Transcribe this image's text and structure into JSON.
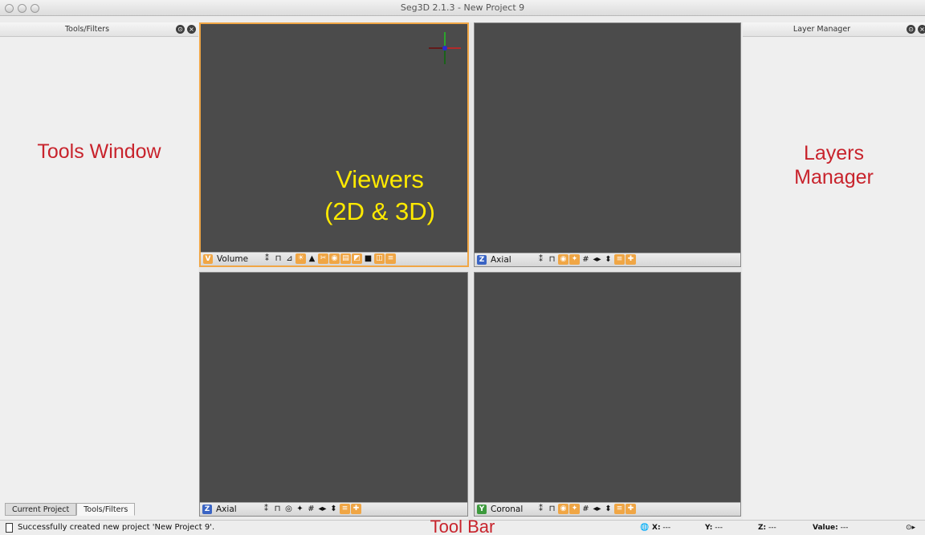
{
  "window": {
    "title": "Seg3D  2.1.3 - New Project 9"
  },
  "tools_panel": {
    "title": "Tools/Filters",
    "annotation": "Tools Window",
    "tabs": [
      "Current Project",
      "Tools/Filters"
    ],
    "active_tab": 1
  },
  "layer_panel": {
    "title": "Layer Manager",
    "annotation_line1": "Layers",
    "annotation_line2": "Manager"
  },
  "viewers": [
    {
      "badge": "V",
      "badge_color": "#f0a645",
      "label": "Volume",
      "active": true
    },
    {
      "badge": "Z",
      "badge_color": "#3a64c4",
      "label": "Axial",
      "active": false
    },
    {
      "badge": "Z",
      "badge_color": "#3a64c4",
      "label": "Axial",
      "active": false
    },
    {
      "badge": "Y",
      "badge_color": "#3d9a3d",
      "label": "Coronal",
      "active": false
    }
  ],
  "viewer_annotation": {
    "line1": "Viewers",
    "line2": "(2D & 3D)"
  },
  "statusbar": {
    "message": "Successfully created new project 'New Project 9'.",
    "x_label": "X:",
    "x_value": "---",
    "y_label": "Y:",
    "y_value": "---",
    "z_label": "Z:",
    "z_value": "---",
    "value_label": "Value:",
    "value_value": "---"
  },
  "toolbar_annotation": "Tool Bar",
  "colors": {
    "accent": "#f0a645",
    "annotation_red": "#c8232c",
    "annotation_yellow": "#ffea00",
    "viewer_bg": "#4b4b4b"
  },
  "icons": {
    "volume_viewer": [
      "fullscreen-icon",
      "lock-icon",
      "ruler-icon",
      "light-icon",
      "cone-icon",
      "cut-icon",
      "iso-icon",
      "overlay-icon",
      "slice-icon",
      "box-icon",
      "window-icon",
      "note-icon"
    ],
    "axial_viewer": [
      "fullscreen-icon",
      "lock-icon",
      "eye-icon",
      "picking-icon",
      "grid-icon",
      "flip-h-icon",
      "flip-v-icon",
      "note-icon",
      "plus-icon"
    ]
  }
}
